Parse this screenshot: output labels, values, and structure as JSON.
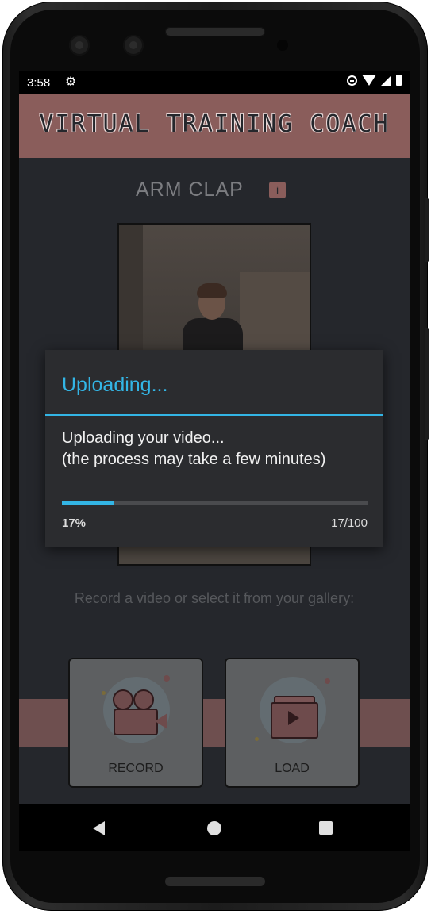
{
  "status_bar": {
    "time": "3:58"
  },
  "app": {
    "title": "VIRTUAL TRAINING COACH"
  },
  "exercise": {
    "name": "ARM CLAP",
    "info_icon": "info-icon"
  },
  "prompt": {
    "text": "Record a video or select it from your gallery:"
  },
  "buttons": {
    "record": "RECORD",
    "load": "LOAD"
  },
  "dialog": {
    "title": "Uploading...",
    "message_line1": "Uploading your video...",
    "message_line2": "(the process may take a few minutes)",
    "progress_percent": "17%",
    "progress_count": "17/100",
    "progress_value": 0.17,
    "accent_color": "#33b5e5"
  },
  "colors": {
    "header": "#8a5d5b",
    "background": "#25272c"
  }
}
